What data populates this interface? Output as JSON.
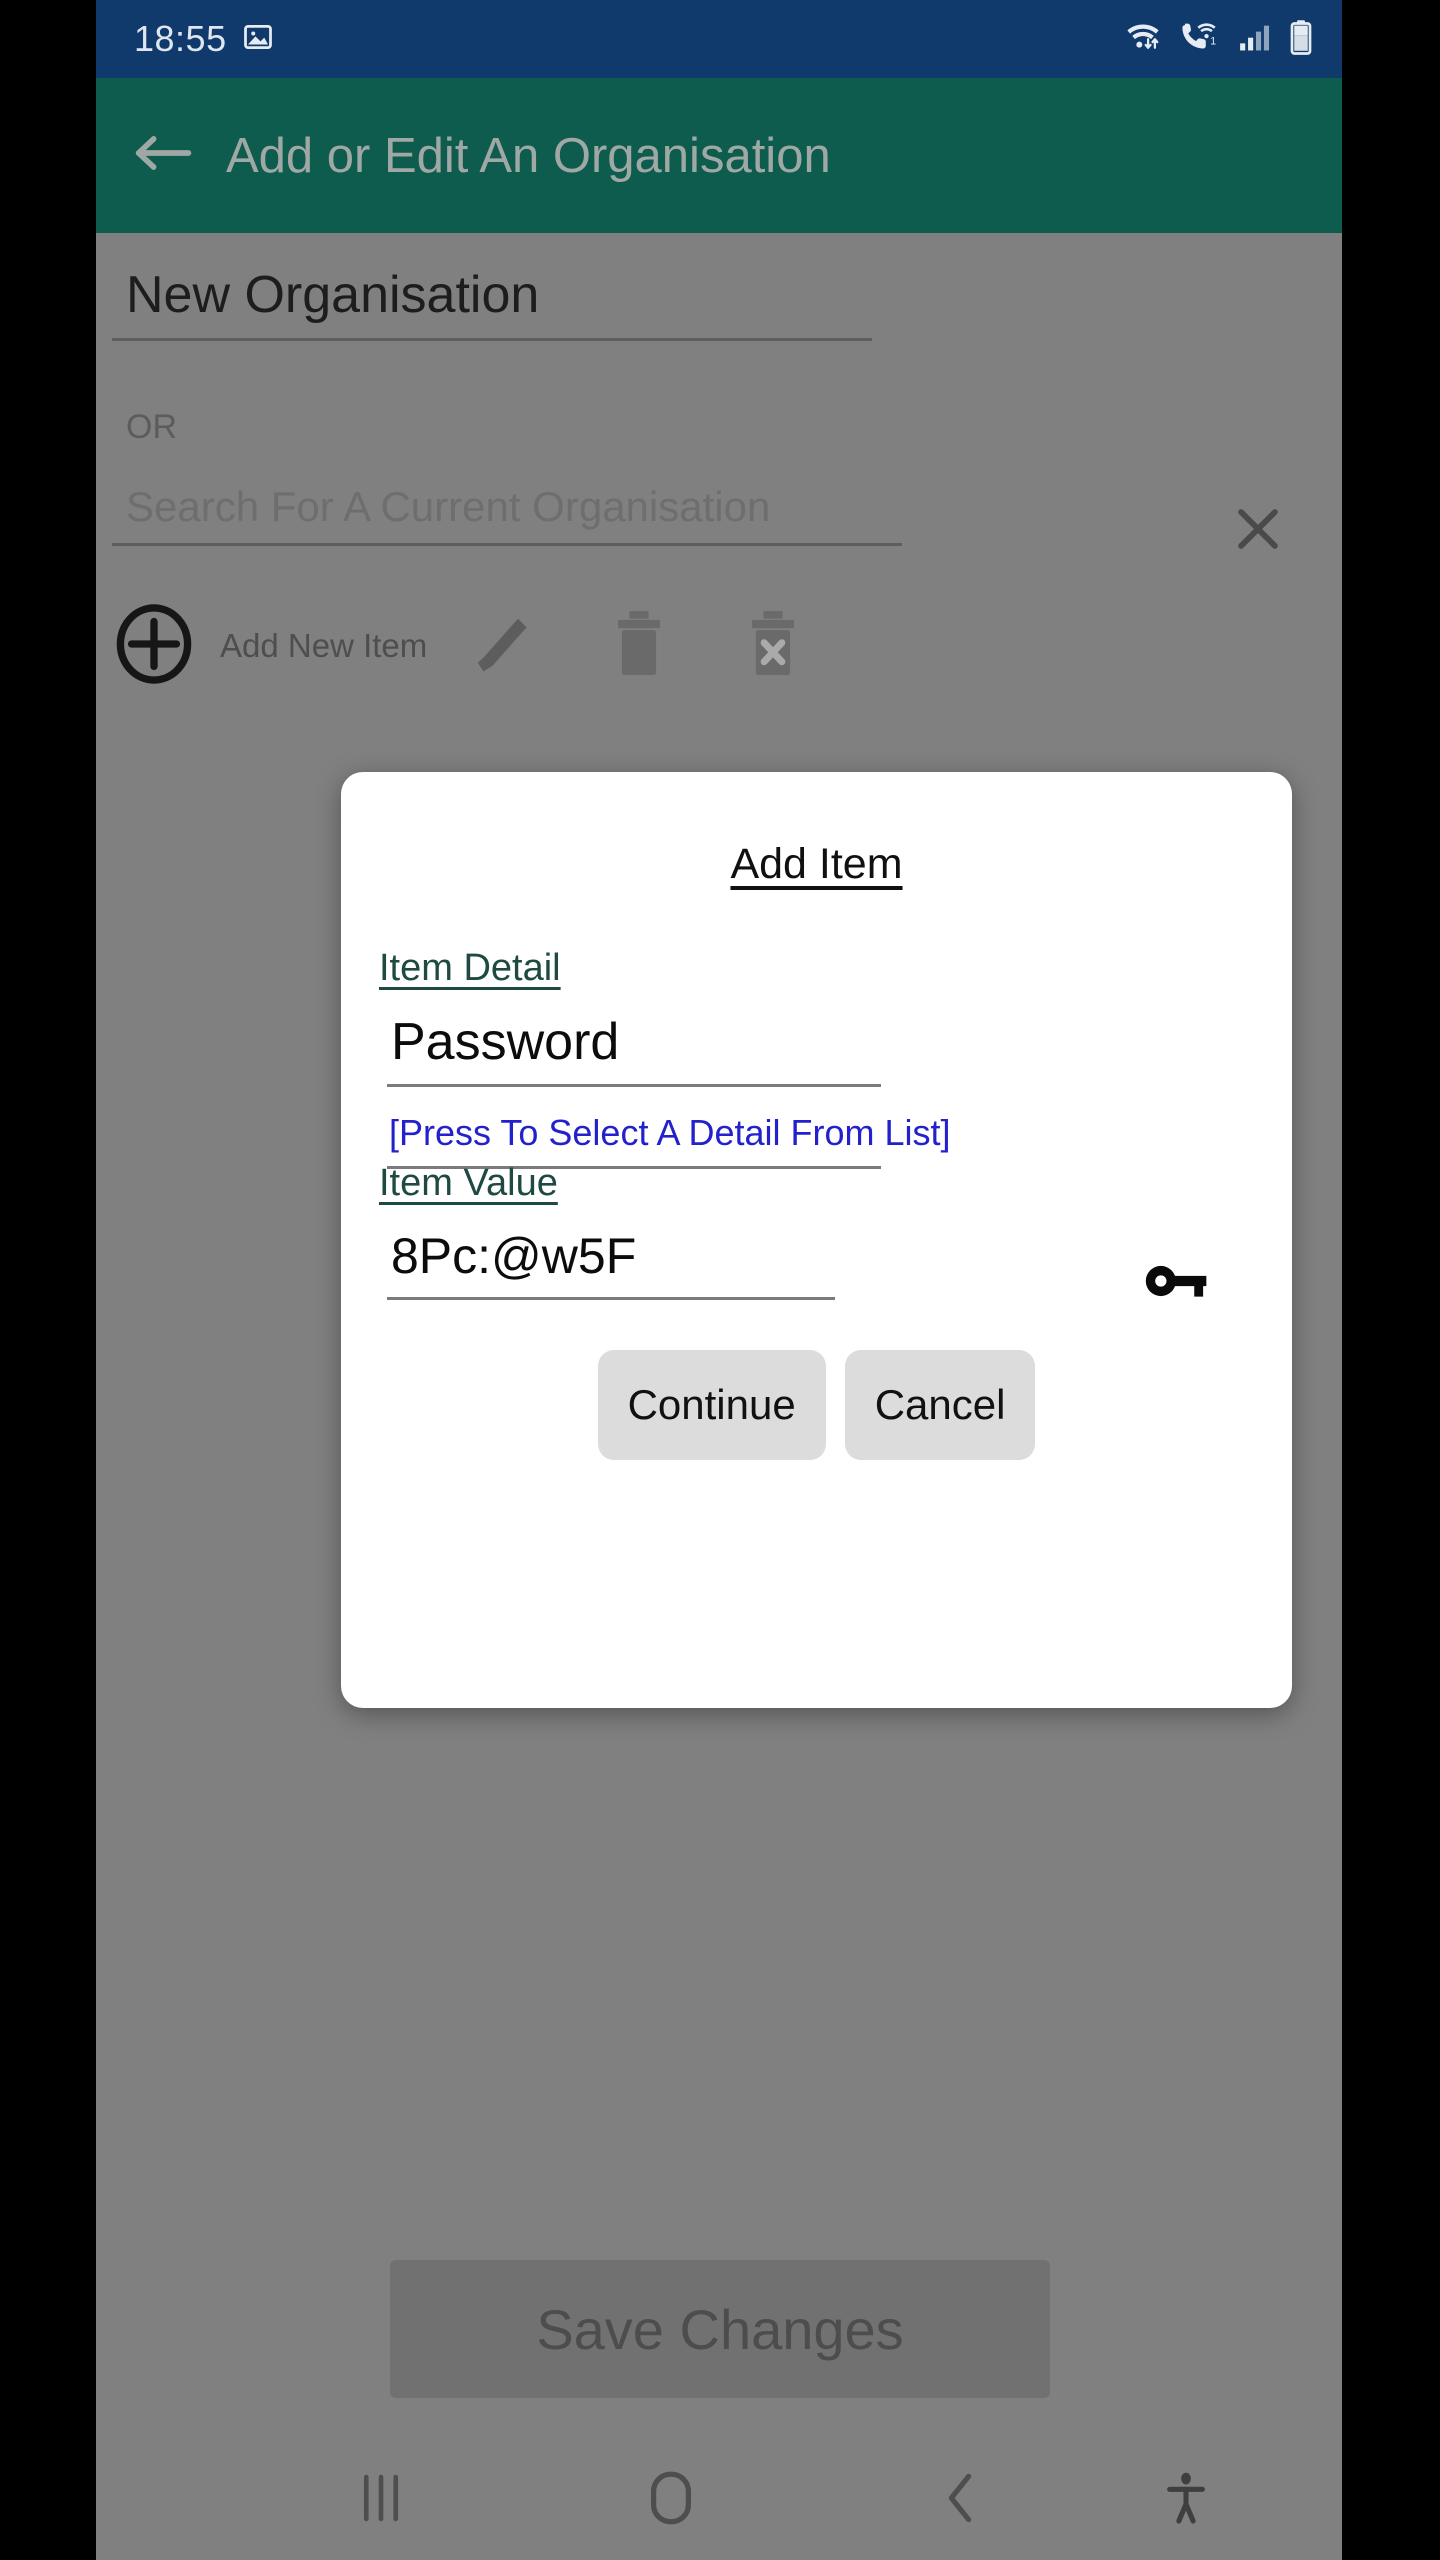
{
  "status_bar": {
    "time": "18:55",
    "left_icons": [
      "image-icon"
    ],
    "right_icons": [
      "wifi-data-icon",
      "wifi-calling-icon",
      "signal-bars-icon",
      "battery-icon"
    ],
    "sim_badge": "1",
    "background_color": "#103a6b"
  },
  "app_bar": {
    "title": "Add or Edit An Organisation",
    "back_icon": "arrow-left-icon",
    "background_color": "#0d5c4d"
  },
  "form": {
    "org_name_value": "New Organisation",
    "or_label": "OR",
    "org_search_placeholder": "Search For A Current Organisation",
    "clear_icon": "close-icon",
    "toolbar": {
      "add_icon": "plus-circle-icon",
      "add_label": "Add New Item",
      "edit_icon": "pencil-icon",
      "delete_icon": "trash-icon",
      "delete_all_icon": "trash-x-icon"
    },
    "save_changes_label": "Save Changes"
  },
  "dialog": {
    "title": "Add Item",
    "item_detail_label": "Item Detail",
    "item_detail_value": "Password",
    "detail_picker_text": "[Press To Select A Detail From List]",
    "detail_picker_color": "#2321cc",
    "item_value_label": "Item Value",
    "item_value_value": "8Pc:@w5F",
    "generate_icon": "key-icon",
    "continue_label": "Continue",
    "cancel_label": "Cancel"
  },
  "nav_bar": {
    "recents_icon": "recents-icon",
    "home_icon": "home-icon",
    "back_icon": "chevron-left-icon",
    "accessibility_icon": "accessibility-icon"
  }
}
